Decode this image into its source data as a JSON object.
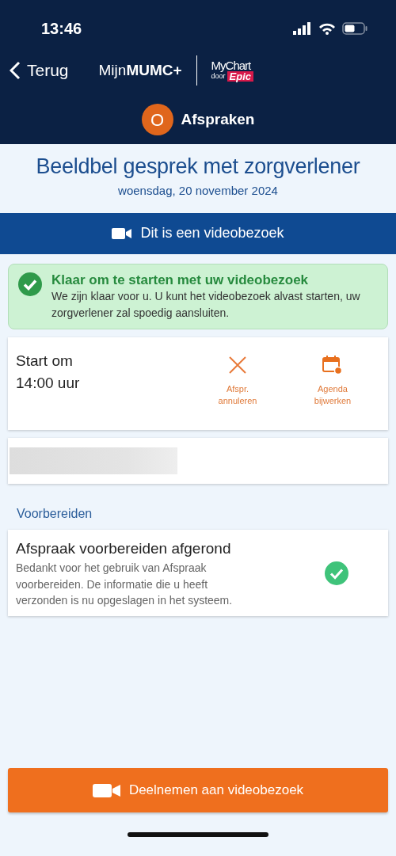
{
  "status_bar": {
    "time": "13:46"
  },
  "nav": {
    "back": "Terug",
    "brand": "Mijn**MUMC+**",
    "partner": {
      "name": "MyChart",
      "by": "door",
      "vendor": "Epic"
    }
  },
  "section": {
    "initial": "O",
    "title": "Afspraken"
  },
  "appointment": {
    "title": "Beeldbel gesprek met zorgverlener",
    "date": "woensdag, 20 november 2024"
  },
  "banner": {
    "text": "Dit is een videobezoek"
  },
  "alert": {
    "title": "Klaar om te starten met uw videobezoek",
    "text": "We zijn klaar voor u. U kunt het videobezoek alvast starten, uw zorgverlener zal spoedig aansluiten."
  },
  "time_card": {
    "start_label": "Start om",
    "start_time": "14:00 uur",
    "actions": [
      {
        "kind": "cancel",
        "label": "Afspr. annuleren"
      },
      {
        "kind": "calendar",
        "label": "Agenda bijwerken"
      }
    ]
  },
  "prepare": {
    "heading": "Voorbereiden",
    "items": [
      {
        "title": "Afspraak voorbereiden afgerond",
        "text": "Bedankt voor het gebruik van Afspraak voorbereiden. De informatie die u heeft verzonden is nu opgeslagen in het systeem.",
        "done": true
      }
    ]
  },
  "join_button": {
    "label": "Deelnemen aan videobezoek"
  }
}
